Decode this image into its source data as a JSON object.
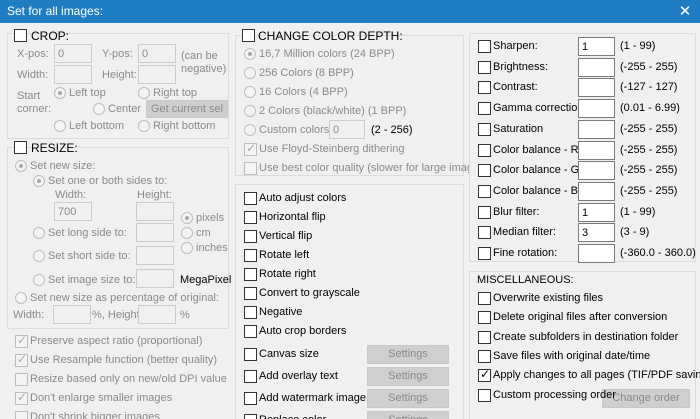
{
  "window": {
    "title": "Set for all images:",
    "close": "✕"
  },
  "crop": {
    "header": "CROP:",
    "xpos_label": "X-pos:",
    "xpos_value": "0",
    "ypos_label": "Y-pos:",
    "ypos_value": "0",
    "can_be_negative": "(can be\nnegative)",
    "width_label": "Width:",
    "width_value": "",
    "height_label": "Height:",
    "height_value": "",
    "start_corner_label": "Start\ncorner:",
    "left_top": "Left top",
    "right_top": "Right top",
    "center": "Center",
    "get_current_sel": "Get current sel",
    "left_bottom": "Left bottom",
    "right_bottom": "Right bottom"
  },
  "resize": {
    "header": "RESIZE:",
    "set_new_size": "Set new size:",
    "set_one_or_both": "Set one or both sides to:",
    "width_label": "Width:",
    "height_label": "Height:",
    "width_value": "700",
    "height_value": "",
    "pixels": "pixels",
    "cm": "cm",
    "inches": "inches",
    "set_long_side": "Set long side to:",
    "set_short_side": "Set short side to:",
    "set_image_size": "Set image size to:",
    "megapixel": "MegaPixel",
    "set_percentage": "Set new size as percentage of original:",
    "pct_width_label": "Width:",
    "pct_height_label": "%, Height:",
    "pct_suffix": "%",
    "preserve_aspect": "Preserve aspect ratio (proportional)",
    "use_resample": "Use Resample function (better quality)",
    "resize_dpi": "Resize based only on new/old DPI value",
    "dont_enlarge": "Don't enlarge smaller images",
    "dont_shrink": "Don't shrink bigger images"
  },
  "color_depth": {
    "header": "CHANGE COLOR DEPTH:",
    "options": [
      "16,7 Million colors (24 BPP)",
      "256 Colors (8 BPP)",
      "16 Colors (4 BPP)",
      "2 Colors (black/white) (1 BPP)"
    ],
    "custom_label": "Custom colors:",
    "custom_value": "0",
    "custom_range": "(2 - 256)",
    "floyd": "Use Floyd-Steinberg dithering",
    "best_quality": "Use best color quality (slower for large images)"
  },
  "operations": {
    "items": [
      "Auto adjust colors",
      "Horizontal flip",
      "Vertical flip",
      "Rotate left",
      "Rotate right",
      "Convert to grayscale",
      "Negative",
      "Auto crop borders"
    ],
    "with_settings": [
      "Canvas size",
      "Add overlay text",
      "Add watermark image",
      "Replace color"
    ],
    "settings_label": "Settings"
  },
  "adjustments": {
    "items": [
      {
        "label": "Sharpen:",
        "value": "1",
        "range": "(1  -  99)"
      },
      {
        "label": "Brightness:",
        "value": "",
        "range": "(-255  -  255)"
      },
      {
        "label": "Contrast:",
        "value": "",
        "range": "(-127  -  127)"
      },
      {
        "label": "Gamma correction:",
        "value": "",
        "range": "(0.01  -  6.99)"
      },
      {
        "label": "Saturation",
        "value": "",
        "range": "(-255  -  255)"
      },
      {
        "label": "Color balance - R:",
        "value": "",
        "range": "(-255  -  255)"
      },
      {
        "label": "Color balance - G:",
        "value": "",
        "range": "(-255  -  255)"
      },
      {
        "label": "Color balance - B:",
        "value": "",
        "range": "(-255  -  255)"
      },
      {
        "label": "Blur filter:",
        "value": "1",
        "range": "(1  -  99)"
      },
      {
        "label": "Median filter:",
        "value": "3",
        "range": "(3  -  9)"
      },
      {
        "label": "Fine rotation:",
        "value": "",
        "range": "(-360.0  -  360.0)"
      }
    ]
  },
  "misc": {
    "header": "MISCELLANEOUS:",
    "items": [
      {
        "label": "Overwrite existing files",
        "checked": false
      },
      {
        "label": "Delete original files after conversion",
        "checked": false
      },
      {
        "label": "Create subfolders in destination folder",
        "checked": false
      },
      {
        "label": "Save files with original date/time",
        "checked": false
      },
      {
        "label": "Apply changes to all pages (TIF/PDF saving)",
        "checked": true
      },
      {
        "label": "Custom processing order",
        "checked": false
      }
    ],
    "change_order": "Change order"
  },
  "colors": {
    "titlebar": "#1e7dc3",
    "disabled_text": "#8a8a8a"
  }
}
